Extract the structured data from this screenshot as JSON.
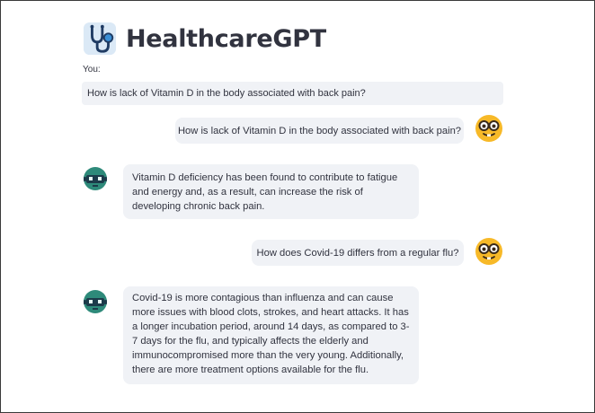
{
  "app": {
    "title": "HealthcareGPT",
    "logo_icon": "stethoscope-icon"
  },
  "input": {
    "label": "You:",
    "value": "How is lack of Vitamin D in the body associated with back pain?"
  },
  "messages": [
    {
      "role": "user",
      "text": "How is lack of Vitamin D in the body associated with back pain?",
      "avatar": "nerd-face-icon"
    },
    {
      "role": "assistant",
      "text": "Vitamin D deficiency has been found to contribute to fatigue and energy and, as a result, can increase the risk of developing chronic back pain.",
      "avatar": "robot-icon"
    },
    {
      "role": "user",
      "text": "How does Covid-19 differs from a regular flu?",
      "avatar": "nerd-face-icon"
    },
    {
      "role": "assistant",
      "text": "Covid-19 is more contagious than influenza and can cause more issues with blood clots, strokes, and heart attacks. It has a longer incubation period, around 14 days, as compared to 3-7 days for the flu, and typically affects the elderly and immunocompromised more than the very young. Additionally, there are more treatment options available for the flu.",
      "avatar": "robot-icon"
    }
  ],
  "colors": {
    "bubble_bg": "#f0f2f6",
    "text": "#31333f",
    "bot_green": "#2e8a7a",
    "emoji_yellow": "#f7b928"
  }
}
